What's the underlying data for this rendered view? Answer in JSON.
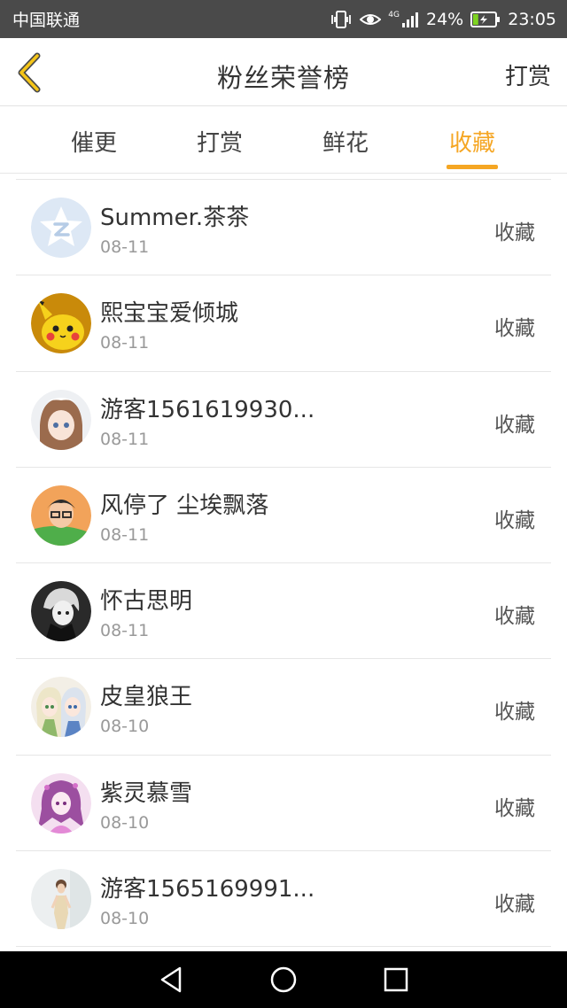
{
  "status_bar": {
    "carrier": "中国联通",
    "network": "4G",
    "battery": "24%",
    "time": "23:05",
    "battery_level": 0.24
  },
  "header": {
    "title": "粉丝荣誉榜",
    "right_action": "打赏"
  },
  "tabs": [
    {
      "label": "催更",
      "active": false
    },
    {
      "label": "打赏",
      "active": false
    },
    {
      "label": "鲜花",
      "active": false
    },
    {
      "label": "收藏",
      "active": true
    }
  ],
  "list": [
    {
      "name": "Summer.茶茶",
      "date": "08-11",
      "action": "收藏",
      "avatar": "default-avatar-icon"
    },
    {
      "name": "熙宝宝爱倾城",
      "date": "08-11",
      "action": "收藏",
      "avatar": "pikachu-avatar"
    },
    {
      "name": "游客1561619930...",
      "date": "08-11",
      "action": "收藏",
      "avatar": "anime-girl-avatar"
    },
    {
      "name": "风停了 尘埃飘落",
      "date": "08-11",
      "action": "收藏",
      "avatar": "boy-glasses-avatar"
    },
    {
      "name": "怀古思明",
      "date": "08-11",
      "action": "收藏",
      "avatar": "dark-anime-avatar"
    },
    {
      "name": "皮皇狼王",
      "date": "08-10",
      "action": "收藏",
      "avatar": "anime-pair-avatar"
    },
    {
      "name": "紫灵慕雪",
      "date": "08-10",
      "action": "收藏",
      "avatar": "purple-anime-avatar"
    },
    {
      "name": "游客1565169991...",
      "date": "08-10",
      "action": "收藏",
      "avatar": "woman-photo-avatar"
    }
  ],
  "colors": {
    "accent": "#f5a623",
    "status_bar": "#4a4a4a",
    "nav_bar": "#000000"
  }
}
